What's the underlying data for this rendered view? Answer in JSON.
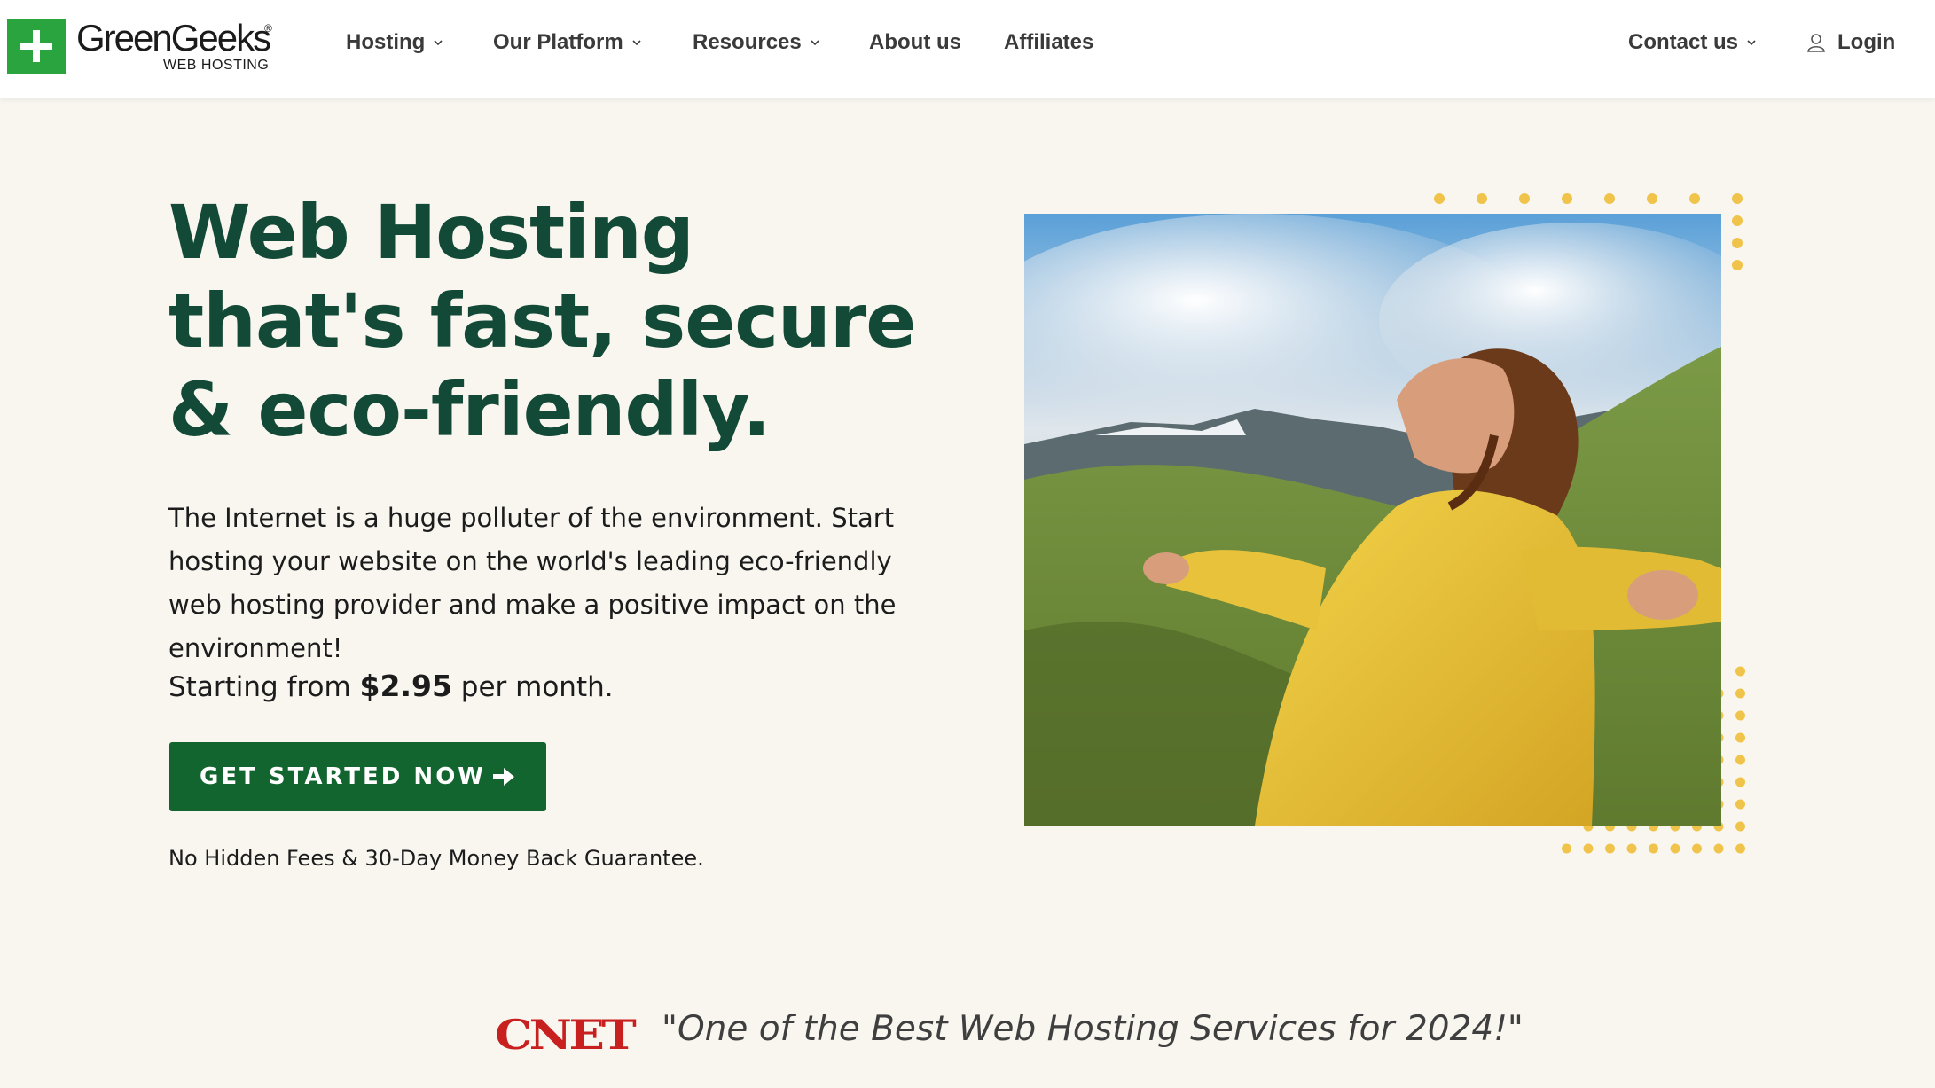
{
  "brand": {
    "name": "GreenGeeks",
    "registered": "®",
    "subtitle": "WEB HOSTING",
    "color": "#2aa43f"
  },
  "nav": {
    "items": [
      {
        "label": "Hosting",
        "has_dropdown": true
      },
      {
        "label": "Our Platform",
        "has_dropdown": true
      },
      {
        "label": "Resources",
        "has_dropdown": true
      },
      {
        "label": "About us",
        "has_dropdown": false
      },
      {
        "label": "Affiliates",
        "has_dropdown": false
      }
    ],
    "contact": {
      "label": "Contact us",
      "has_dropdown": true
    },
    "login": {
      "label": "Login",
      "icon": "user-icon"
    }
  },
  "hero": {
    "title": "Web Hosting that's fast, secure & eco-friendly.",
    "description": "The Internet is a huge polluter of the environment. Start hosting your website on the world's leading eco-friendly web hosting provider and make a positive impact on the environment!",
    "price_prefix": "Starting from",
    "price": "$2.95",
    "price_suffix": "per month.",
    "cta_label": "GET STARTED NOW",
    "cta_color": "#13652f",
    "guarantee": "No Hidden Fees & 30-Day Money Back Guarantee.",
    "title_color": "#134a37",
    "accent_dots_color": "#f0c44a"
  },
  "press": {
    "logo": "CNET",
    "quote": "\"One of the Best Web Hosting Services for 2024!\""
  }
}
